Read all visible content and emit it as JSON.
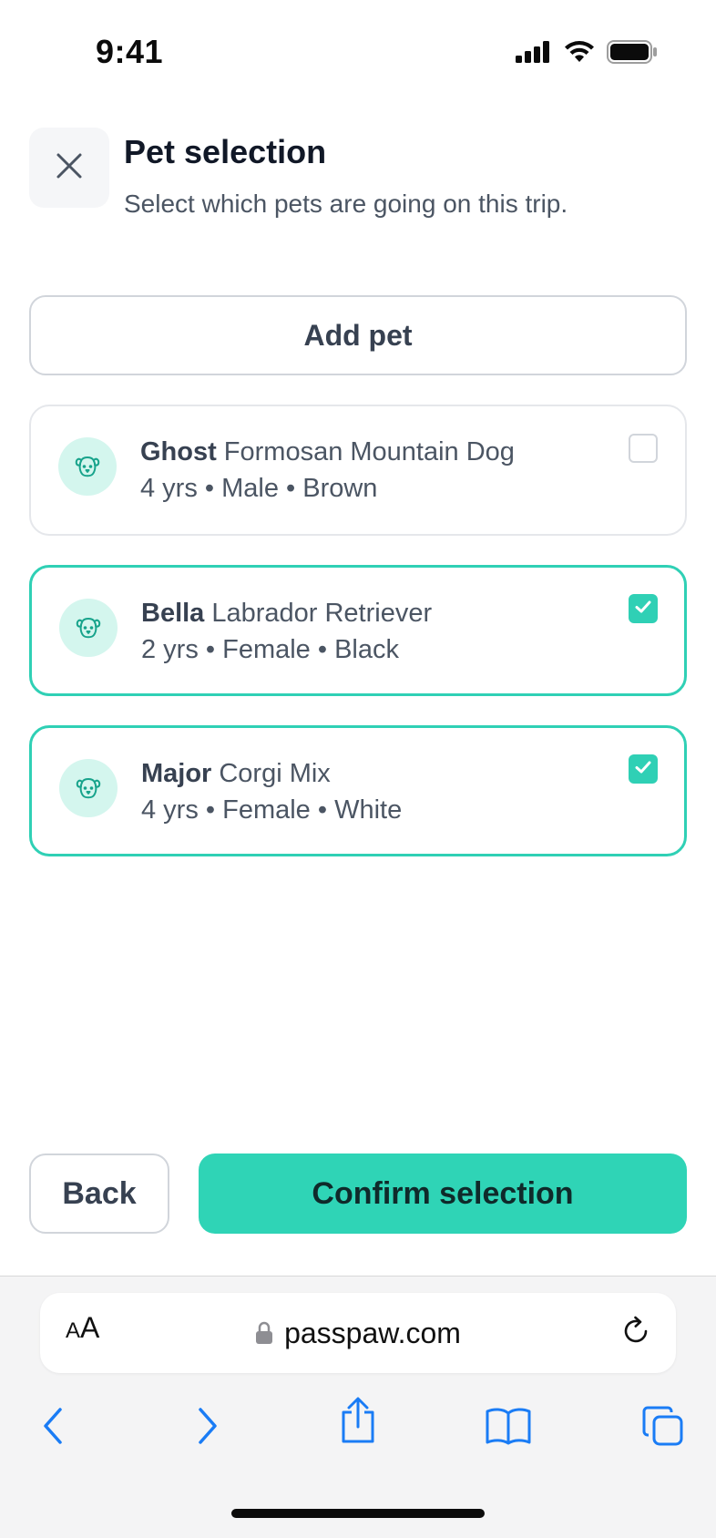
{
  "status_bar": {
    "time": "9:41"
  },
  "header": {
    "title": "Pet selection",
    "subtitle": "Select which pets are going on this trip."
  },
  "add_pet_label": "Add pet",
  "pets": [
    {
      "name": "Ghost",
      "breed": "Formosan Mountain Dog",
      "details": "4 yrs • Male • Brown",
      "selected": false
    },
    {
      "name": "Bella",
      "breed": "Labrador Retriever",
      "details": "2 yrs • Female • Black",
      "selected": true
    },
    {
      "name": "Major",
      "breed": "Corgi Mix",
      "details": "4 yrs • Female • White",
      "selected": true
    }
  ],
  "footer": {
    "back_label": "Back",
    "confirm_label": "Confirm selection"
  },
  "browser": {
    "aa_label_small": "A",
    "aa_label_large": "A",
    "url": "passpaw.com"
  },
  "colors": {
    "accent": "#2fd4b6",
    "selected_border": "#2fd0b5",
    "avatar_bg": "#d4f6ee",
    "browser_blue": "#1a7cf5"
  }
}
